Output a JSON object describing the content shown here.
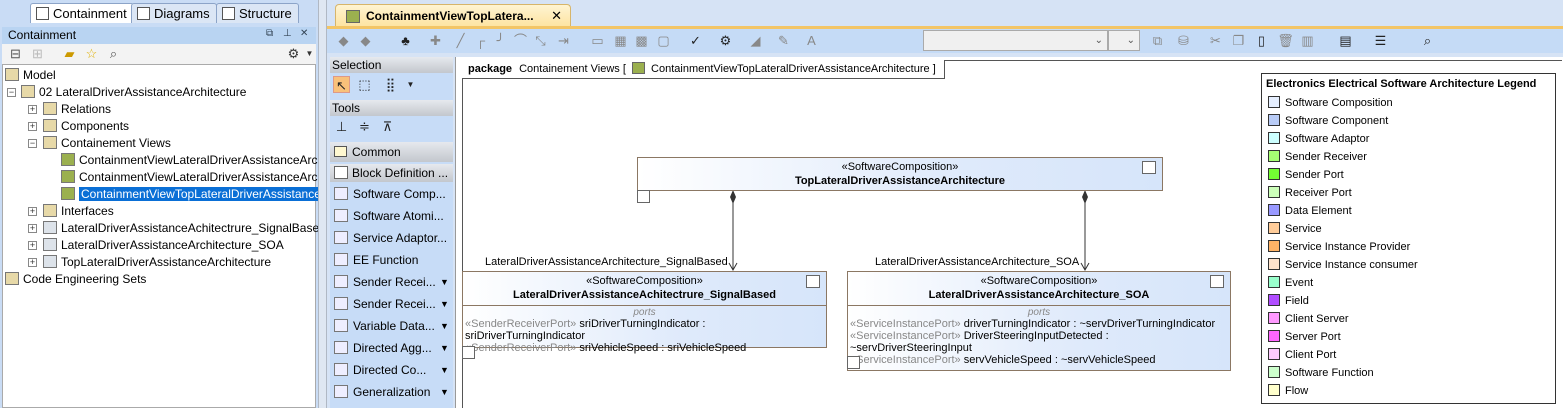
{
  "left_panel": {
    "tabs": [
      {
        "label": "Containment",
        "active": true
      },
      {
        "label": "Diagrams"
      },
      {
        "label": "Structure"
      }
    ],
    "header_title": "Containment",
    "tree": [
      {
        "label": "Model",
        "level": 0,
        "icon": "model-icon"
      },
      {
        "label": "02 LateralDriverAssistanceArchitecture",
        "level": 0,
        "expanded": true,
        "icon": "package-icon"
      },
      {
        "label": "Relations",
        "level": 1,
        "icon": "relations-icon"
      },
      {
        "label": "Components",
        "level": 1,
        "icon": "folder-icon"
      },
      {
        "label": "Containement Views",
        "level": 1,
        "expanded": true,
        "icon": "folder-icon"
      },
      {
        "label": "ContainmentViewLateralDriverAssistanceArcl",
        "level": 2,
        "icon": "diagram-icon"
      },
      {
        "label": "ContainmentViewLateralDriverAssistanceArcl",
        "level": 2,
        "icon": "diagram-icon"
      },
      {
        "label": "ContainmentViewTopLateralDriverAssistance",
        "level": 2,
        "icon": "diagram-icon",
        "selected": true
      },
      {
        "label": "Interfaces",
        "level": 1,
        "icon": "folder-icon"
      },
      {
        "label": "LateralDriverAssistanceAchitectrure_SignalBased",
        "level": 1,
        "icon": "block-icon"
      },
      {
        "label": "LateralDriverAssistanceArchitecture_SOA",
        "level": 1,
        "icon": "block-icon"
      },
      {
        "label": "TopLateralDriverAssistanceArchitecture",
        "level": 1,
        "icon": "block-icon"
      },
      {
        "label": "Code Engineering Sets",
        "level": 0,
        "icon": "code-sets-icon"
      }
    ]
  },
  "editor": {
    "tab_title": "ContainmentViewTopLatera...",
    "close_glyph": "✕"
  },
  "palette": {
    "sections": {
      "selection": "Selection",
      "tools": "Tools",
      "common": "Common",
      "block_definition": "Block Definition ..."
    },
    "items": [
      {
        "label": "Software Comp..."
      },
      {
        "label": "Software Atomi..."
      },
      {
        "label": "Service Adaptor..."
      },
      {
        "label": "EE Function"
      },
      {
        "label": "Sender Recei...",
        "dropdown": true
      },
      {
        "label": "Sender Recei...",
        "dropdown": true
      },
      {
        "label": "Variable Data...",
        "dropdown": true
      },
      {
        "label": "Directed Agg...",
        "dropdown": true
      },
      {
        "label": "Directed Co...",
        "dropdown": true
      },
      {
        "label": "Generalization",
        "dropdown": true
      }
    ]
  },
  "diagram": {
    "frame": {
      "kind": "package",
      "owner": "Containement Views [",
      "name": "ContainmentViewTopLateralDriverAssistanceArchitecture",
      "close": "]"
    },
    "top_block": {
      "stereotype": "«SoftwareComposition»",
      "name": "TopLateralDriverAssistanceArchitecture"
    },
    "left_block": {
      "role": "LateralDriverAssistanceArchitecture_SignalBased",
      "stereotype": "«SoftwareComposition»",
      "name": "LateralDriverAssistanceAchitectrure_SignalBased",
      "ports_header": "ports",
      "ports": [
        {
          "stereo": "«SenderReceiverPort»",
          "text": "sriDriverTurningIndicator : sriDriverTurningIndicator"
        },
        {
          "stereo": "«SenderReceiverPort»",
          "text": "sriVehicleSpeed : sriVehicleSpeed"
        }
      ]
    },
    "right_block": {
      "role": "LateralDriverAssistanceArchitecture_SOA",
      "stereotype": "«SoftwareComposition»",
      "name": "LateralDriverAssistanceArchitecture_SOA",
      "ports_header": "ports",
      "ports": [
        {
          "stereo": "«ServiceInstancePort»",
          "text": "driverTurningIndicator : ~servDriverTurningIndicator"
        },
        {
          "stereo": "«ServiceInstancePort»",
          "text": "DriverSteeringInputDetected : ~servDriverSteeringInput"
        },
        {
          "stereo": "«ServiceInstancePort»",
          "text": "servVehicleSpeed : ~servVehicleSpeed"
        }
      ]
    },
    "legend": {
      "title": "Electronics Electrical Software Architecture Legend",
      "items": [
        {
          "label": "Software Composition",
          "color": "#e6efff"
        },
        {
          "label": "Software Component",
          "color": "#b9ccf7"
        },
        {
          "label": "Software Adaptor",
          "color": "#ccffff"
        },
        {
          "label": "Sender Receiver",
          "color": "#a6ff73"
        },
        {
          "label": "Sender Port",
          "color": "#73ff33"
        },
        {
          "label": "Receiver Port",
          "color": "#ccffb9"
        },
        {
          "label": "Data Element",
          "color": "#9999ff"
        },
        {
          "label": "Service",
          "color": "#ffcc99"
        },
        {
          "label": "Service Instance Provider",
          "color": "#ffb366"
        },
        {
          "label": "Service Instance consumer",
          "color": "#ffe3cc"
        },
        {
          "label": "Event",
          "color": "#99ffcc"
        },
        {
          "label": "Field",
          "color": "#b04dff"
        },
        {
          "label": "Client Server",
          "color": "#ff99ff"
        },
        {
          "label": "Server Port",
          "color": "#ff66ff"
        },
        {
          "label": "Client Port",
          "color": "#ffccff"
        },
        {
          "label": "Software Function",
          "color": "#ccffcc"
        },
        {
          "label": "Flow",
          "color": "#ffffcc"
        }
      ]
    }
  }
}
